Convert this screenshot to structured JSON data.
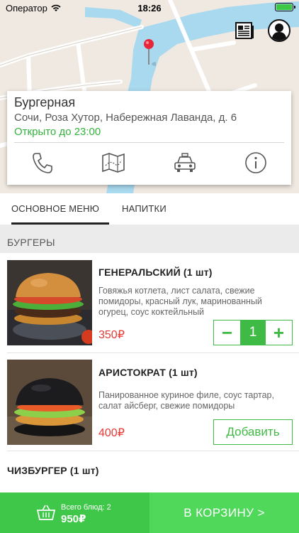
{
  "status_bar": {
    "carrier": "Оператор",
    "time": "18:26",
    "battery_level": 1.0
  },
  "header": {
    "icons": [
      "news-icon",
      "profile-icon"
    ]
  },
  "restaurant": {
    "name": "Бургерная",
    "address": "Сочи, Роза Хутор, Набережная Лаванда, д. 6",
    "open_status": "Открыто до 23:00",
    "actions": [
      "phone-icon",
      "map-icon",
      "taxi-icon",
      "info-icon"
    ]
  },
  "tabs": [
    {
      "label": "ОСНОВНОЕ МЕНЮ",
      "active": true
    },
    {
      "label": "НАПИТКИ",
      "active": false
    }
  ],
  "section": {
    "title": "БУРГЕРЫ"
  },
  "items": [
    {
      "name": "ГЕНЕРАЛЬСКИЙ (1 шт)",
      "description": "Говяжья котлета, лист салата, свежие помидоры, красный лук, маринованный огурец, соус коктейльный",
      "price": "350₽",
      "quantity": "1",
      "minus": "−",
      "plus": "+"
    },
    {
      "name": "АРИСТОКРАТ (1 шт)",
      "description": "Панированное куриное филе, соус тартар, салат айсберг, свежие помидоры",
      "price": "400₽",
      "add_label": "Добавить"
    },
    {
      "name": "ЧИЗБУРГЕР (1 шт)"
    }
  ],
  "cart": {
    "count_label": "Всего блюд:  2",
    "total": "950₽",
    "checkout_label": "В КОРЗИНУ  >"
  },
  "colors": {
    "accent_green": "#3ec748",
    "open_green": "#33b33b",
    "price_red": "#e53935",
    "river_blue": "#a9d9ef",
    "map_land": "#efe9e1"
  }
}
